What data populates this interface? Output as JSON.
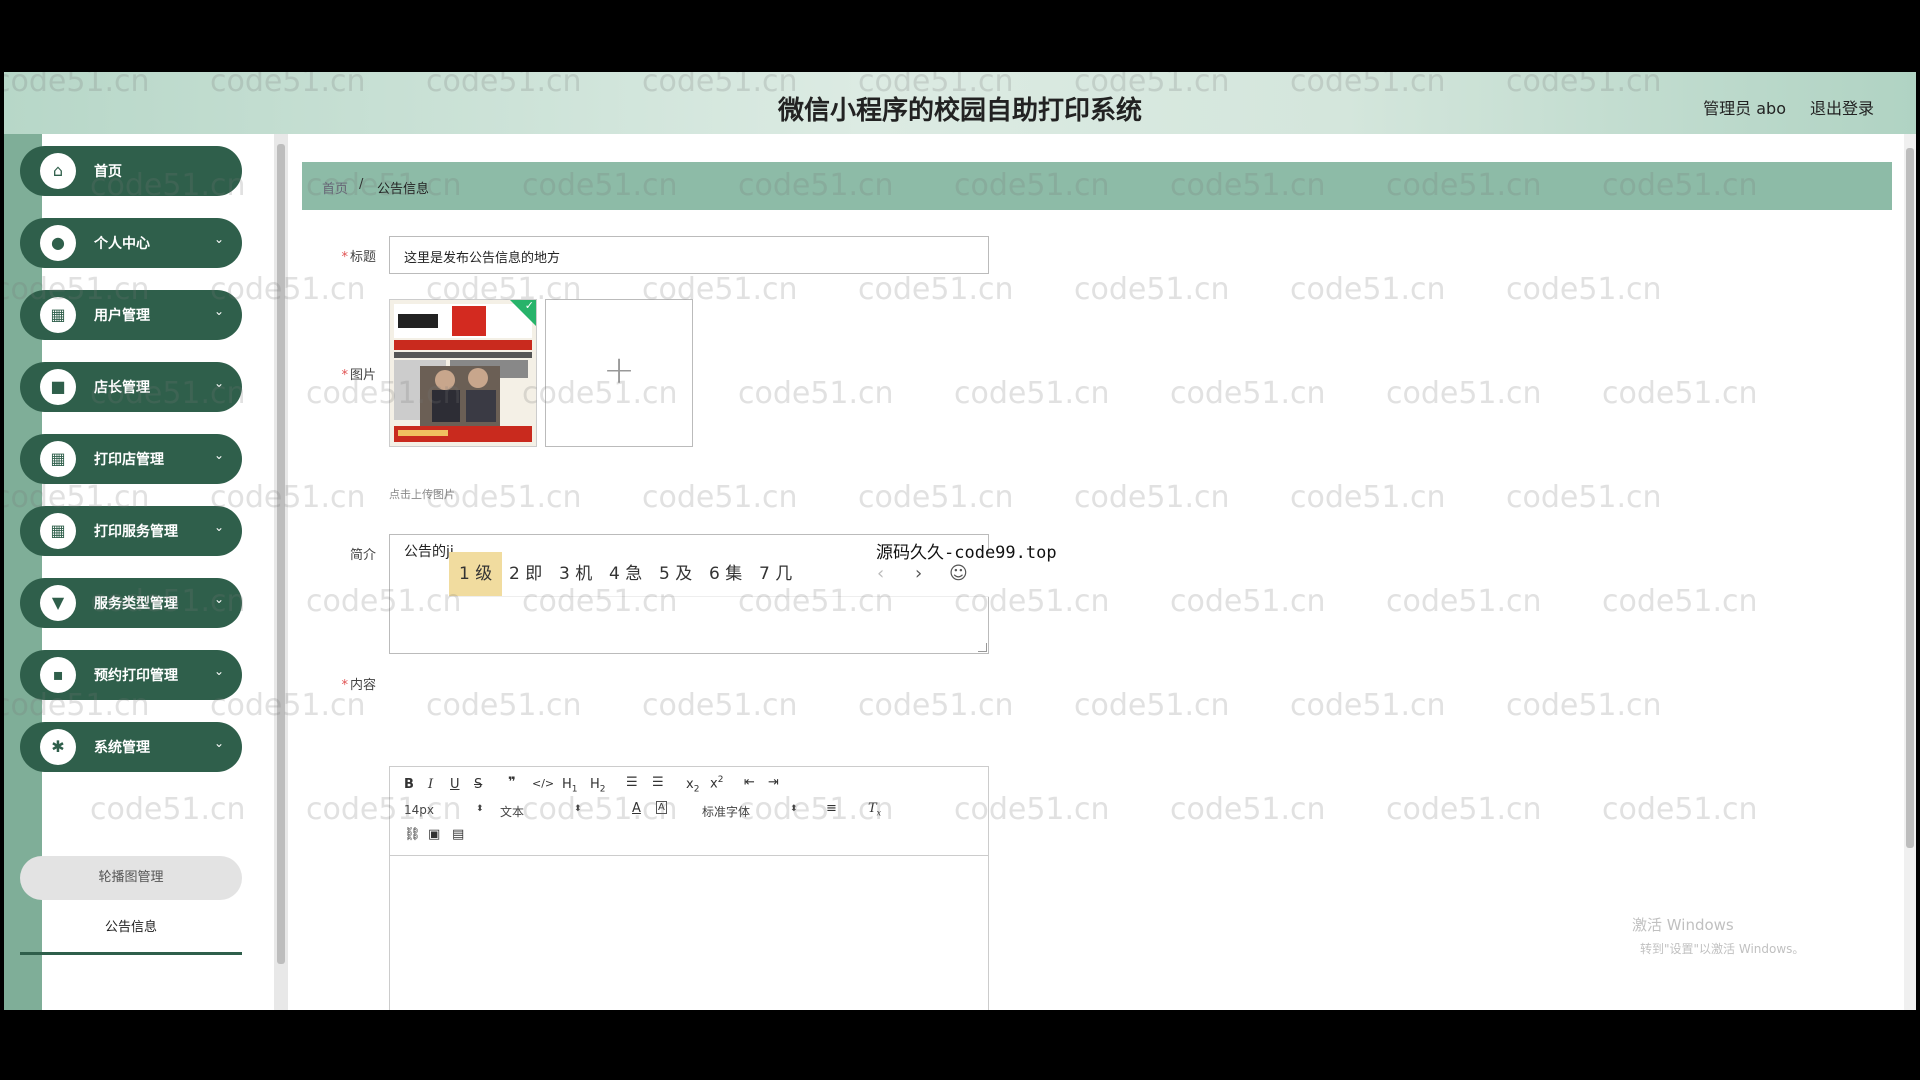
{
  "header": {
    "app_title": "微信小程序的校园自助打印系统",
    "user_label": "管理员 abo",
    "logout_label": "退出登录"
  },
  "watermark": "code51.cn",
  "sidebar": {
    "items": [
      {
        "label": "首页",
        "icon": "home-icon",
        "glyph": "⌂",
        "expandable": false
      },
      {
        "label": "个人中心",
        "icon": "user-icon",
        "glyph": "●",
        "expandable": true
      },
      {
        "label": "用户管理",
        "icon": "grid-icon",
        "glyph": "▦",
        "expandable": true
      },
      {
        "label": "店长管理",
        "icon": "briefcase-icon",
        "glyph": "■",
        "expandable": true
      },
      {
        "label": "打印店管理",
        "icon": "grid-icon",
        "glyph": "▦",
        "expandable": true
      },
      {
        "label": "打印服务管理",
        "icon": "grid-icon",
        "glyph": "▦",
        "expandable": true
      },
      {
        "label": "服务类型管理",
        "icon": "trophy-icon",
        "glyph": "▼",
        "expandable": true
      },
      {
        "label": "预约打印管理",
        "icon": "camera-icon",
        "glyph": "▪",
        "expandable": true
      },
      {
        "label": "系统管理",
        "icon": "settings-icon",
        "glyph": "✱",
        "expandable": true
      }
    ],
    "sub_items": [
      {
        "label": "轮播图管理"
      },
      {
        "label": "公告信息"
      }
    ]
  },
  "breadcrumb": {
    "home": "首页",
    "separator": "/",
    "current": "公告信息"
  },
  "form": {
    "title_label": "标题",
    "title_value": "这里是发布公告信息的地方",
    "image_label": "图片",
    "upload_tip": "点击上传图片",
    "intro_label": "简介",
    "intro_value": "公告的jj",
    "content_label": "内容"
  },
  "ime": {
    "source_label": "源码久久-code99.top",
    "candidates": [
      "1 级",
      "2 即",
      "3 机",
      "4 急",
      "5 及",
      "6 集",
      "7 几"
    ],
    "selected_index": 0
  },
  "editor_toolbar": {
    "font_size": "14px",
    "block_format": "文本",
    "font_family": "标准字体"
  },
  "os_overlay": {
    "line1": "激活 Windows",
    "line2": "转到\"设置\"以激活 Windows。"
  }
}
